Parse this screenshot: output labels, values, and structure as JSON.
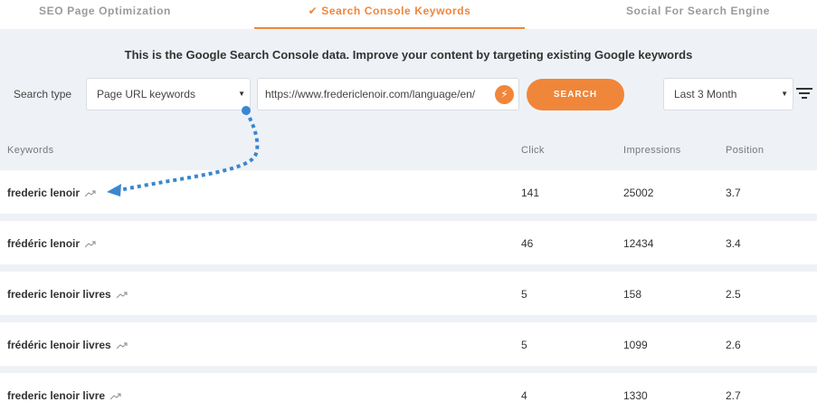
{
  "tabs": [
    {
      "label": "SEO Page Optimization",
      "active": false
    },
    {
      "label": "Search Console Keywords",
      "active": true,
      "icon": "check-icon"
    },
    {
      "label": "Social For Search Engine",
      "active": false
    }
  ],
  "intro_text": "This is the Google Search Console data. Improve your content by targeting existing Google keywords",
  "search": {
    "type_label": "Search type",
    "type_value": "Page URL keywords",
    "url_value": "https://www.fredericlenoir.com/language/en/",
    "button_label": "SEARCH",
    "range_value": "Last 3 Month"
  },
  "table": {
    "headers": {
      "keywords": "Keywords",
      "click": "Click",
      "impressions": "Impressions",
      "position": "Position"
    },
    "rows": [
      {
        "keyword": "frederic lenoir",
        "click": "141",
        "impressions": "25002",
        "position": "3.7"
      },
      {
        "keyword": "frédéric lenoir",
        "click": "46",
        "impressions": "12434",
        "position": "3.4"
      },
      {
        "keyword": "frederic lenoir livres",
        "click": "5",
        "impressions": "158",
        "position": "2.5"
      },
      {
        "keyword": "frédéric lenoir livres",
        "click": "5",
        "impressions": "1099",
        "position": "2.6"
      },
      {
        "keyword": "frederic lenoir livre",
        "click": "4",
        "impressions": "1330",
        "position": "2.7"
      }
    ]
  },
  "colors": {
    "accent": "#f0863a",
    "panel": "#eef2f6",
    "annotation": "#3a86d0"
  }
}
